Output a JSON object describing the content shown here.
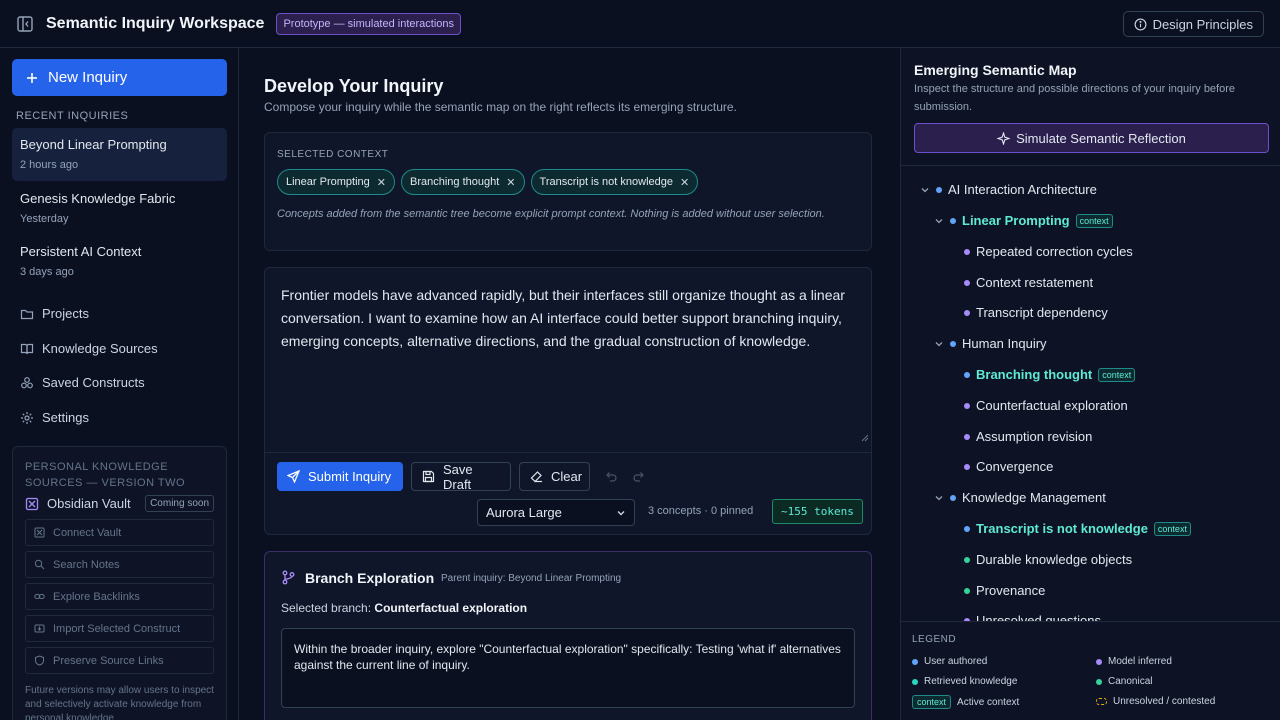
{
  "header": {
    "title": "Semantic Inquiry Workspace",
    "badge": "Prototype — simulated interactions",
    "design_principles": "Design Principles"
  },
  "sidebar": {
    "new_inquiry": "New Inquiry",
    "recent_header": "RECENT INQUIRIES",
    "recent": [
      {
        "title": "Beyond Linear Prompting",
        "time": "2 hours ago"
      },
      {
        "title": "Genesis Knowledge Fabric",
        "time": "Yesterday"
      },
      {
        "title": "Persistent AI Context",
        "time": "3 days ago"
      }
    ],
    "nav": [
      {
        "label": "Projects",
        "icon": "folder-icon"
      },
      {
        "label": "Knowledge Sources",
        "icon": "book-icon"
      },
      {
        "label": "Saved Constructs",
        "icon": "constructs-icon"
      },
      {
        "label": "Settings",
        "icon": "gear-icon"
      }
    ],
    "pks": {
      "header": "PERSONAL KNOWLEDGE SOURCES — VERSION TWO",
      "vault": "Obsidian Vault",
      "coming_soon": "Coming soon",
      "buttons": [
        "Connect Vault",
        "Search Notes",
        "Explore Backlinks",
        "Import Selected Construct",
        "Preserve Source Links"
      ],
      "note": "Future versions may allow users to inspect and selectively activate knowledge from personal knowledge"
    }
  },
  "main": {
    "title": "Develop Your Inquiry",
    "subtitle": "Compose your inquiry while the semantic map on the right reflects its emerging structure.",
    "context": {
      "header": "SELECTED CONTEXT",
      "chips": [
        "Linear Prompting",
        "Branching thought",
        "Transcript is not knowledge"
      ],
      "note": "Concepts added from the semantic tree become explicit prompt context. Nothing is added without user selection."
    },
    "editor": {
      "text": "Frontier models have advanced rapidly, but their interfaces still organize thought as a linear conversation. I want to examine how an AI interface could better support branching inquiry, emerging concepts, alternative directions, and the gradual construction of knowledge.",
      "submit": "Submit Inquiry",
      "save": "Save Draft",
      "clear": "Clear",
      "model": "Aurora Large",
      "stats": "3 concepts · 0 pinned",
      "tokens": "~155 tokens"
    },
    "branch": {
      "title": "Branch Exploration",
      "parent": "Parent inquiry: Beyond Linear Prompting",
      "selected_label": "Selected branch:",
      "selected_value": "Counterfactual exploration",
      "text": "Within the broader inquiry, explore \"Counterfactual exploration\" specifically: Testing 'what if' alternatives against the current line of inquiry."
    }
  },
  "map": {
    "title": "Emerging Semantic Map",
    "subtitle": "Inspect the structure and possible directions of your inquiry before submission.",
    "simulate": "Simulate Semantic Reflection",
    "context_tag": "context",
    "nodes": [
      {
        "label": "AI Interaction Architecture",
        "color": "#60a5fa"
      },
      {
        "label": "Linear Prompting",
        "color": "#60a5fa"
      },
      {
        "label": "Repeated correction cycles",
        "color": "#a78bfa"
      },
      {
        "label": "Context restatement",
        "color": "#a78bfa"
      },
      {
        "label": "Transcript dependency",
        "color": "#a78bfa"
      },
      {
        "label": "Human Inquiry",
        "color": "#60a5fa"
      },
      {
        "label": "Branching thought",
        "color": "#60a5fa"
      },
      {
        "label": "Counterfactual exploration",
        "color": "#a78bfa"
      },
      {
        "label": "Assumption revision",
        "color": "#a78bfa"
      },
      {
        "label": "Convergence",
        "color": "#a78bfa"
      },
      {
        "label": "Knowledge Management",
        "color": "#60a5fa"
      },
      {
        "label": "Transcript is not knowledge",
        "color": "#60a5fa"
      },
      {
        "label": "Durable knowledge objects",
        "color": "#34d399"
      },
      {
        "label": "Provenance",
        "color": "#34d399"
      },
      {
        "label": "Unresolved questions",
        "color": "#a78bfa"
      }
    ],
    "legend": {
      "header": "LEGEND",
      "user_authored": "User authored",
      "model_inferred": "Model inferred",
      "retrieved": "Retrieved knowledge",
      "canonical": "Canonical",
      "context_tag": "context",
      "active_context": "Active context",
      "unresolved": "Unresolved / contested"
    }
  }
}
